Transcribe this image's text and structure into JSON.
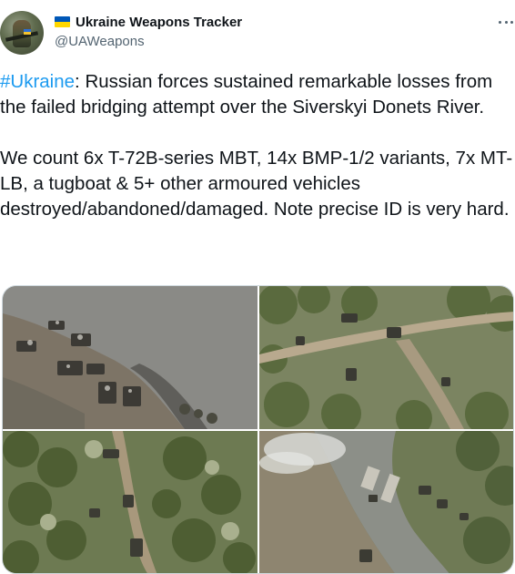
{
  "author": {
    "display_name": "Ukraine Weapons Tracker",
    "handle": "@UAWeapons",
    "avatar_icon": "avatar-photo",
    "name_flag_icon": "ukraine-flag-icon"
  },
  "tweet": {
    "hashtag": "#Ukraine",
    "text_part1": ": Russian forces sustained remarkable losses from the failed bridging attempt over the Siverskyi Donets River.",
    "text_part2": "We count 6x T-72B-series MBT, 14x BMP-1/2 variants, 7x MT-LB, a tugboat & 5+ other armoured vehicles destroyed/abandoned/damaged. Note precise ID is very hard."
  },
  "media": {
    "photos": [
      {
        "icon": "aerial-photo-riverbank"
      },
      {
        "icon": "aerial-photo-field-road"
      },
      {
        "icon": "aerial-photo-forest-track"
      },
      {
        "icon": "aerial-photo-river-bridge"
      }
    ]
  },
  "colors": {
    "link": "#1d9bf0",
    "secondary_text": "#536471",
    "border": "#cfd9de"
  }
}
